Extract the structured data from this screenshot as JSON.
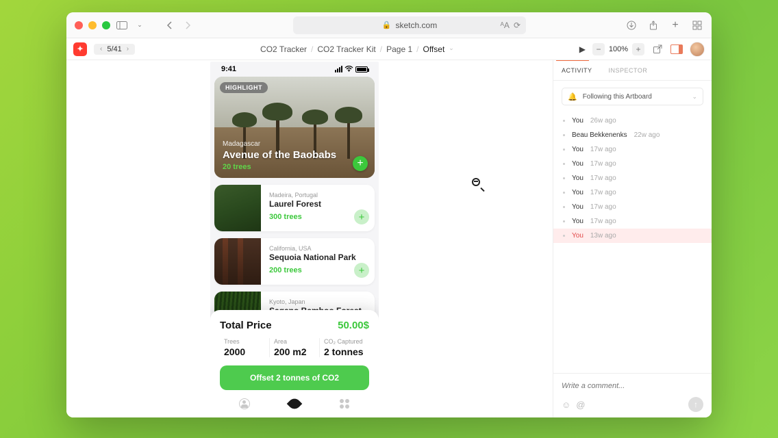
{
  "browser": {
    "url": "sketch.com"
  },
  "app": {
    "artboard_index": "5/41",
    "zoom": "100%",
    "breadcrumb": [
      "CO2 Tracker",
      "CO2 Tracker Kit",
      "Page 1",
      "Offset"
    ]
  },
  "artboard": {
    "time": "9:41",
    "hero": {
      "badge": "HIGHLIGHT",
      "location": "Madagascar",
      "title": "Avenue of the Baobabs",
      "trees": "20 trees"
    },
    "items": [
      {
        "location": "Madeira, Portugal",
        "title": "Laurel Forest",
        "trees": "300 trees"
      },
      {
        "location": "California, USA",
        "title": "Sequoia National Park",
        "trees": "200 trees"
      },
      {
        "location": "Kyoto, Japan",
        "title": "Sagano Bamboo Forest",
        "trees": ""
      }
    ],
    "summary": {
      "title": "Total Price",
      "price": "50.00$",
      "stats": [
        {
          "label": "Trees",
          "value": "2000"
        },
        {
          "label": "Area",
          "value": "200 m2"
        },
        {
          "label": "CO₂ Captured",
          "value": "2 tonnes"
        }
      ],
      "cta": "Offset 2 tonnes of CO2"
    }
  },
  "side": {
    "tabs": [
      "ACTIVITY",
      "INSPECTOR"
    ],
    "follow": "Following this Artboard",
    "activity": [
      {
        "who": "You",
        "when": "26w ago",
        "hl": false
      },
      {
        "who": "Beau Bekkenenks",
        "when": "22w ago",
        "hl": false
      },
      {
        "who": "You",
        "when": "17w ago",
        "hl": false
      },
      {
        "who": "You",
        "when": "17w ago",
        "hl": false
      },
      {
        "who": "You",
        "when": "17w ago",
        "hl": false
      },
      {
        "who": "You",
        "when": "17w ago",
        "hl": false
      },
      {
        "who": "You",
        "when": "17w ago",
        "hl": false
      },
      {
        "who": "You",
        "when": "17w ago",
        "hl": false
      },
      {
        "who": "You",
        "when": "13w ago",
        "hl": true
      }
    ],
    "comment_placeholder": "Write a comment..."
  }
}
